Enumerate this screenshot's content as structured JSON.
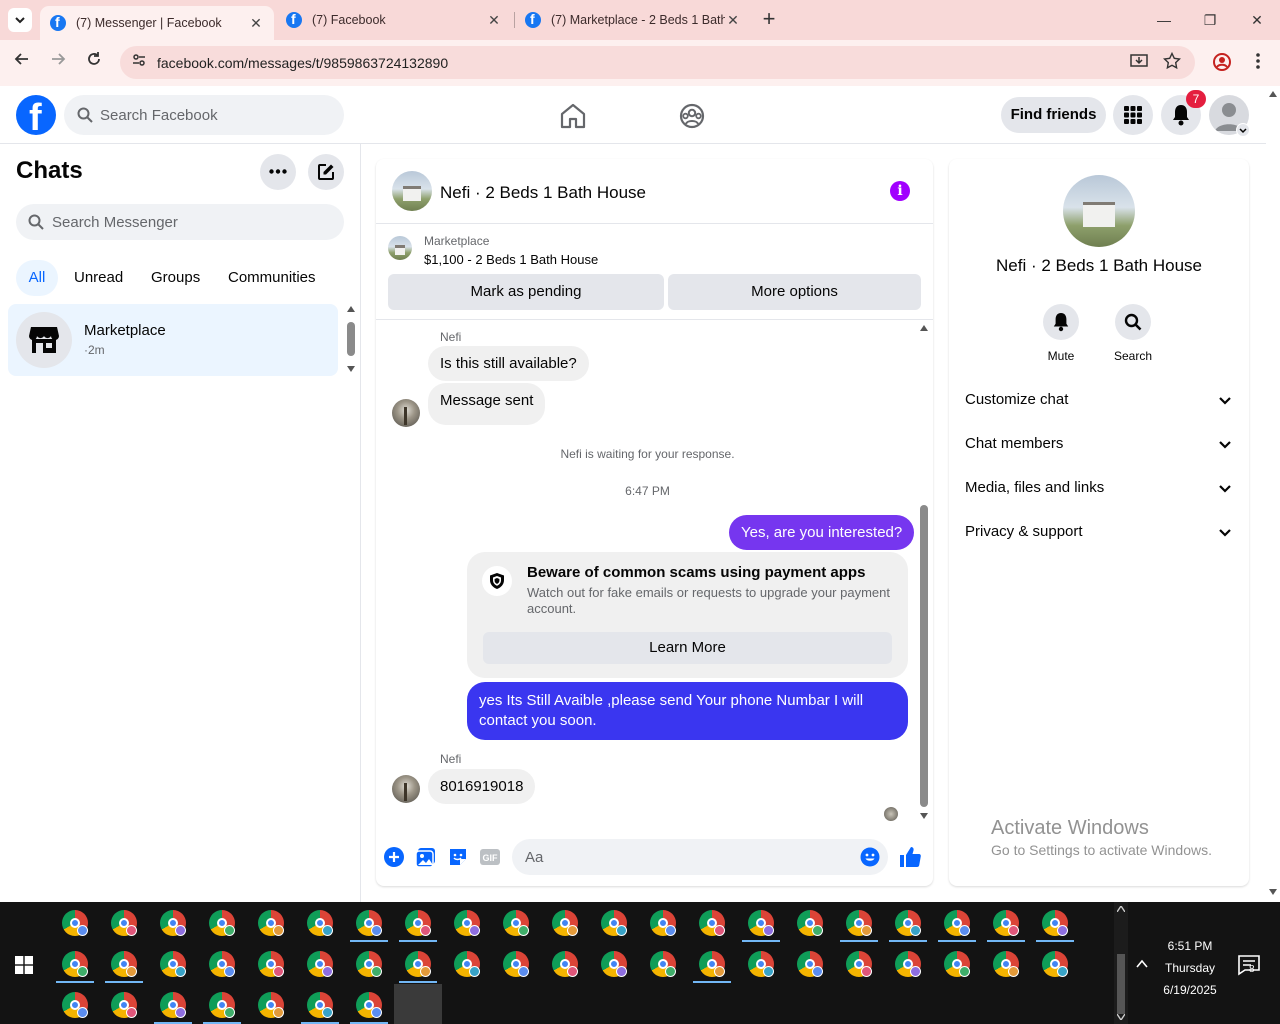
{
  "browser": {
    "tabs": [
      {
        "title": "(7) Messenger | Facebook",
        "active": true
      },
      {
        "title": "(7) Facebook",
        "active": false
      },
      {
        "title": "(7) Marketplace - 2 Beds 1 Bath",
        "active": false
      }
    ],
    "url": "facebook.com/messages/t/9859863724132890"
  },
  "fb_header": {
    "search_placeholder": "Search Facebook",
    "find_friends_label": "Find friends",
    "notification_count": "7"
  },
  "chats_panel": {
    "title": "Chats",
    "search_placeholder": "Search Messenger",
    "filters": [
      "All",
      "Unread",
      "Groups",
      "Communities"
    ],
    "active_filter": "All",
    "items": [
      {
        "name": "Marketplace",
        "time": "·2m"
      }
    ]
  },
  "conversation": {
    "title": "Nefi · 2 Beds 1 Bath House",
    "marketplace_label": "Marketplace",
    "listing": "$1,100 - 2 Beds 1 Bath House",
    "mark_pending_label": "Mark as pending",
    "more_options_label": "More options",
    "messages": {
      "sender_1": "Nefi",
      "msg_1": "Is this still available?",
      "msg_2": "Message sent",
      "waiting": "Nefi is waiting for your response.",
      "timestamp": "6:47 PM",
      "msg_3": "Yes, are you interested?",
      "scam_title": "Beware of common scams using payment apps",
      "scam_body": "Watch out for fake emails or requests to upgrade your payment account.",
      "scam_button": "Learn More",
      "msg_4": "yes Its Still Avaible ,please send Your phone Numbar I will contact you soon.",
      "sender_2": "Nefi",
      "msg_5": "8016919018"
    },
    "composer_placeholder": "Aa"
  },
  "info_panel": {
    "name": "Nefi · 2 Beds 1 Bath House",
    "mute_label": "Mute",
    "search_label": "Search",
    "sections": [
      "Customize chat",
      "Chat members",
      "Media, files and links",
      "Privacy & support"
    ]
  },
  "watermark": {
    "line1": "Activate Windows",
    "line2": "Go to Settings to activate Windows."
  },
  "taskbar": {
    "time": "6:51 PM",
    "day": "Thursday",
    "date": "6/19/2025",
    "notification_count": "8"
  },
  "colors": {
    "accent_blue": "#0866ff",
    "outgoing_purple": "#7636ef",
    "outgoing_blue": "#3a36f0",
    "badge_red": "#e41e3f",
    "tab_strip": "#f8d9d8"
  }
}
